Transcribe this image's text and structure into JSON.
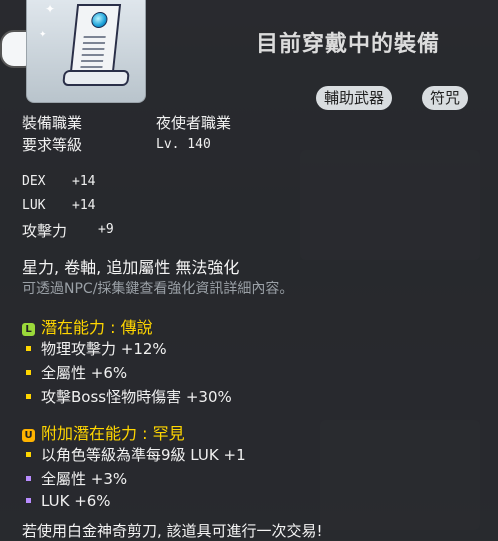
{
  "title": "目前穿戴中的裝備",
  "tags": [
    "輔助武器",
    "符咒"
  ],
  "requirements": {
    "job_label": "裝備職業",
    "job_value": "夜使者職業",
    "level_label": "要求等級",
    "level_value": "Lv. 140"
  },
  "stats": [
    {
      "name": "DEX",
      "value": "+14"
    },
    {
      "name": "LUK",
      "value": "+14"
    },
    {
      "name": "攻擊力",
      "value": "+9"
    }
  ],
  "properties": "星力, 卷軸, 追加屬性 無法強化",
  "hint": "可透過NPC/採集鍵查看強化資訊詳細內容。",
  "potential": {
    "grade_icon": "L",
    "header": "潛在能力 : 傳說",
    "lines": [
      {
        "text": "物理攻擊力 +12%"
      },
      {
        "text": "全屬性 +6%"
      },
      {
        "text": "攻擊Boss怪物時傷害 +30%"
      }
    ],
    "bullet_color": "#ffd600"
  },
  "additional_potential": {
    "grade_icon": "U",
    "header": "附加潛在能力 : 罕見",
    "lines": [
      {
        "text": "以角色等級為準每9級 LUK +1"
      },
      {
        "text": "全屬性 +3%"
      },
      {
        "text": "LUK +6%"
      }
    ],
    "bullet_colors": [
      "#ffd600",
      "#b98cff",
      "#b98cff"
    ]
  },
  "footer": "若使用白金神奇剪刀, 該道具可進行一次交易!"
}
